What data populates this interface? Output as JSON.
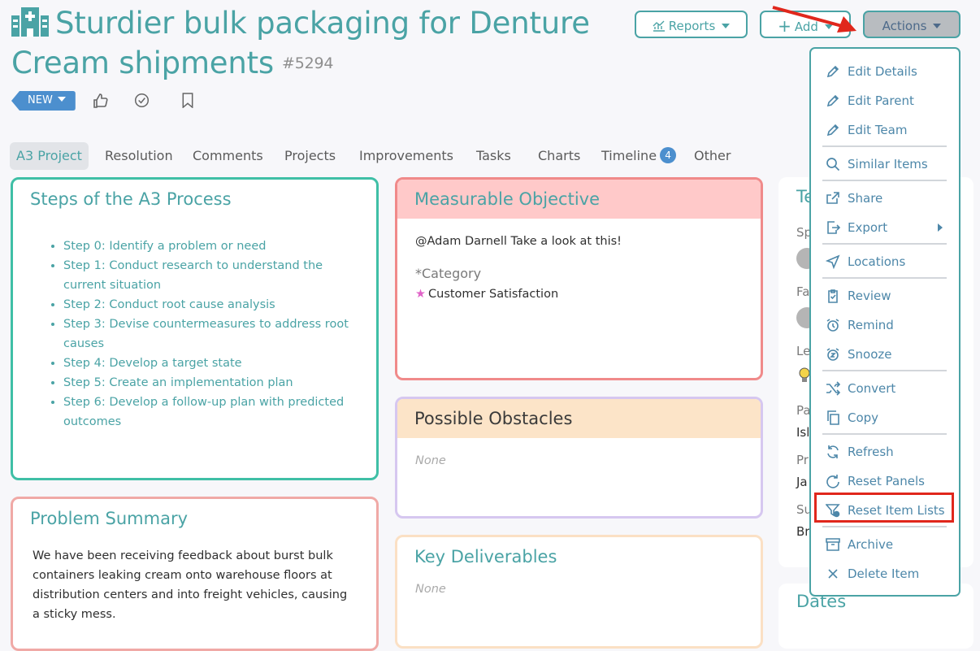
{
  "item": {
    "title": "Sturdier bulk packaging for Denture Cream shipments",
    "number": "#5294",
    "status": "NEW"
  },
  "toolbar": {
    "reports_label": "Reports",
    "add_label": "Add",
    "actions_label": "Actions"
  },
  "tabs": [
    {
      "label": "A3 Project"
    },
    {
      "label": "Resolution"
    },
    {
      "label": "Comments"
    },
    {
      "label": "Projects"
    },
    {
      "label": "Improvements"
    },
    {
      "label": "Tasks"
    },
    {
      "label": "Charts"
    },
    {
      "label": "Timeline",
      "badge": "4"
    },
    {
      "label": "Other"
    }
  ],
  "steps_panel": {
    "title": "Steps of the A3 Process",
    "items": [
      "Step 0: Identify a problem or need",
      "Step 1: Conduct research to understand the current situation",
      "Step 2: Conduct root cause analysis",
      "Step 3: Devise countermeasures to address root causes",
      "Step 4: Develop a target state",
      "Step 5: Create an implementation plan",
      "Step 6: Develop a follow-up plan with predicted outcomes"
    ]
  },
  "problem_panel": {
    "title": "Problem Summary",
    "text": "We have been receiving feedback about burst bulk containers leaking cream onto warehouse floors at distribution centers and into freight vehicles, causing a sticky mess."
  },
  "objective_panel": {
    "title": "Measurable Objective",
    "mention": "@Adam Darnell Take a look at this!",
    "category_label": "*Category",
    "category_value": "Customer Satisfaction"
  },
  "obstacles_panel": {
    "title": "Possible Obstacles",
    "value": "None"
  },
  "deliverables_panel": {
    "title": "Key Deliverables",
    "value": "None"
  },
  "right_panel": {
    "fragments": [
      "Te",
      "Sp",
      "Fa",
      "Le",
      "Pa",
      "Isl",
      "Pr",
      "Ja",
      "Su",
      "Br"
    ]
  },
  "dates_panel": {
    "title": "Dates"
  },
  "actions_menu": {
    "items": [
      {
        "label": "Edit Details",
        "icon": "pencil-icon"
      },
      {
        "label": "Edit Parent",
        "icon": "pencil-icon"
      },
      {
        "label": "Edit Team",
        "icon": "pencil-icon"
      },
      {
        "label": "Similar Items",
        "icon": "search-icon"
      },
      {
        "label": "Share",
        "icon": "share-icon"
      },
      {
        "label": "Export",
        "icon": "export-icon"
      },
      {
        "label": "Locations",
        "icon": "location-arrow-icon"
      },
      {
        "label": "Review",
        "icon": "clipboard-check-icon"
      },
      {
        "label": "Remind",
        "icon": "alarm-clock-icon"
      },
      {
        "label": "Snooze",
        "icon": "snooze-clock-icon"
      },
      {
        "label": "Convert",
        "icon": "shuffle-icon"
      },
      {
        "label": "Copy",
        "icon": "copy-icon"
      },
      {
        "label": "Refresh",
        "icon": "refresh-icon"
      },
      {
        "label": "Reset Panels",
        "icon": "rotate-icon"
      },
      {
        "label": "Reset Item Lists",
        "icon": "filter-reset-icon"
      },
      {
        "label": "Archive",
        "icon": "archive-icon"
      },
      {
        "label": "Delete Item",
        "icon": "close-icon"
      }
    ]
  },
  "colors": {
    "accent": "#4aa3a5",
    "status_blue": "#4c8fce",
    "highlight_red": "#e0271c",
    "menu_text": "#4d87a9"
  }
}
